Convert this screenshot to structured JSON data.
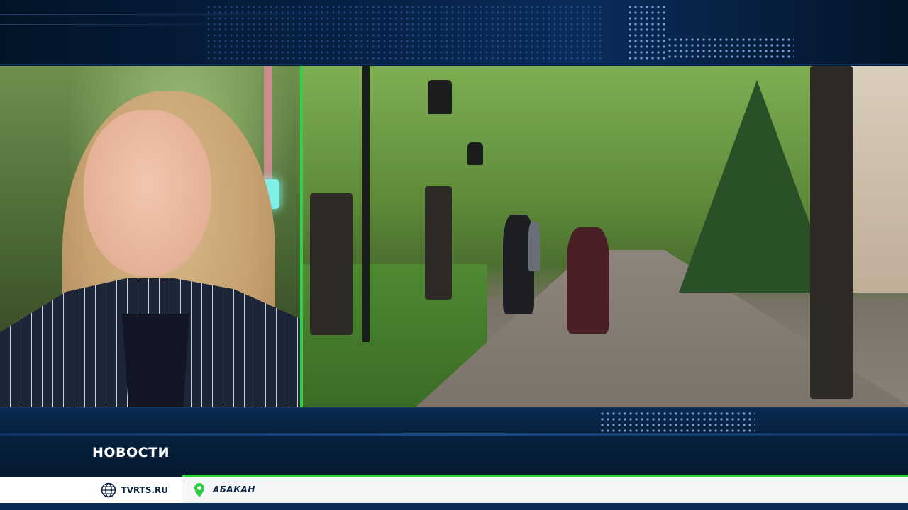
{
  "lower_third": {
    "title": "НОВОСТИ"
  },
  "ticker": {
    "site": "TVRTS.RU",
    "city": "АБАКАН",
    "site_icon": "globe-icon",
    "city_icon": "location-pin-icon"
  },
  "colors": {
    "accent_green": "#2fcf45",
    "band_blue": "#06213f",
    "text_dark": "#0c2341"
  }
}
